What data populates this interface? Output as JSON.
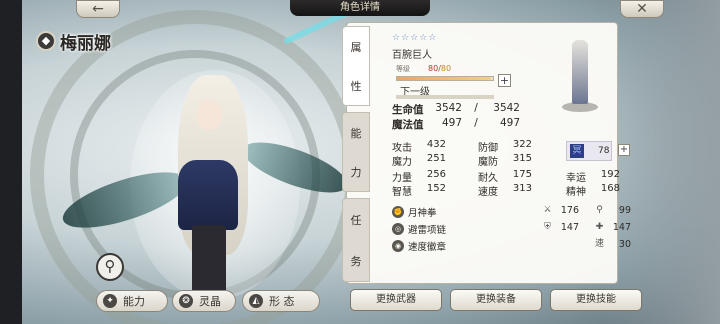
{
  "header": {
    "title": "角色详情",
    "back_icon": "←",
    "close_icon": "✕"
  },
  "character": {
    "name": "梅丽娜",
    "class_icon": "◆",
    "stars": "☆☆☆☆☆",
    "species": "百腕巨人",
    "level_label": "等级",
    "level_current": "80",
    "level_sep": "/",
    "level_max": "80",
    "level_fill_fraction": 0.98,
    "next_level": "下一级"
  },
  "side_tabs": {
    "attributes": [
      "属",
      "性"
    ],
    "ability": [
      "能",
      "力"
    ],
    "quest": [
      "任",
      "务"
    ]
  },
  "vitals": {
    "hp": {
      "label": "生命值",
      "value": "3542",
      "sep": "/",
      "max": "3542"
    },
    "mp": {
      "label": "魔法值",
      "value": "497",
      "sep": "/",
      "max": "497"
    }
  },
  "stats": {
    "attack": {
      "label": "攻击",
      "value": "432"
    },
    "defense": {
      "label": "防御",
      "value": "322"
    },
    "magic": {
      "label": "魔力",
      "value": "251"
    },
    "mdefense": {
      "label": "魔防",
      "value": "315"
    },
    "strength": {
      "label": "力量",
      "value": "256"
    },
    "endurance": {
      "label": "耐久",
      "value": "175"
    },
    "luck": {
      "label": "幸运",
      "value": "192"
    },
    "wisdom": {
      "label": "智慧",
      "value": "152"
    },
    "speed": {
      "label": "速度",
      "value": "313"
    },
    "spirit": {
      "label": "精神",
      "value": "168"
    }
  },
  "element": {
    "icon_text": "冥",
    "value": "78",
    "plus": "+"
  },
  "equipment": {
    "weapon": {
      "name": "月神拳",
      "stat1": "176",
      "stat2": "99"
    },
    "armor": {
      "name": "避雷项链",
      "stat1": "147",
      "stat2": "147"
    },
    "accessory": {
      "name": "速度徽章",
      "stat_label": "速",
      "stat_value": "30"
    }
  },
  "actions": {
    "change_weapon": "更换武器",
    "change_equipment": "更换装备",
    "change_skill": "更换技能"
  },
  "bottom_tabs": {
    "ability": "能力",
    "crystal": "灵晶",
    "form": "形 态"
  },
  "zoom_icon": "⚲"
}
